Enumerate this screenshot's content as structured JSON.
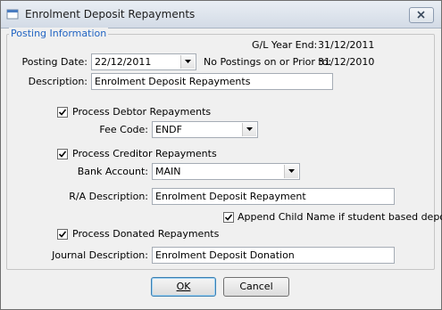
{
  "window": {
    "title": "Enrolment Deposit Repayments",
    "close_symbol": "×"
  },
  "group": {
    "legend": "Posting Information"
  },
  "gl_year_end": {
    "label": "G/L Year End:",
    "value": "31/12/2011"
  },
  "posting_date": {
    "label": "Posting Date:",
    "value": "22/12/2011"
  },
  "no_postings": {
    "label": "No Postings on or Prior to:",
    "value": "31/12/2010"
  },
  "description": {
    "label": "Description:",
    "value": "Enrolment Deposit Repayments"
  },
  "debtor": {
    "checkbox_label": "Process Debtor Repayments",
    "checked": true,
    "fee_code_label": "Fee Code:",
    "fee_code_value": "ENDF"
  },
  "creditor": {
    "checkbox_label": "Process Creditor Repayments",
    "checked": true,
    "bank_account_label": "Bank Account:",
    "bank_account_value": "MAIN",
    "ra_description_label": "R/A Description:",
    "ra_description_value": "Enrolment Deposit Repayment",
    "append_child_label": "Append Child Name if student based deposit",
    "append_checked": true
  },
  "donated": {
    "checkbox_label": "Process Donated Repayments",
    "checked": true,
    "journal_description_label": "Journal Description:",
    "journal_description_value": "Enrolment Deposit Donation"
  },
  "buttons": {
    "ok_label": "OK",
    "cancel_label": "Cancel"
  },
  "colors": {
    "legend": "#2265c3",
    "window_bg": "#f0f0f0",
    "default_border": "#3c7fb1"
  }
}
